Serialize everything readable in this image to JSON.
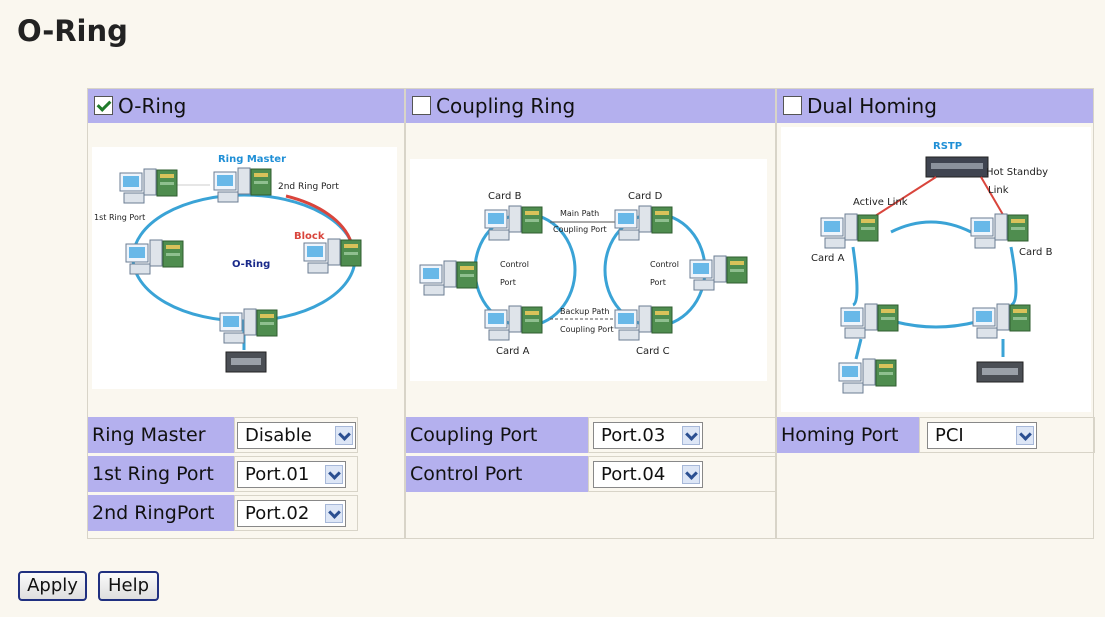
{
  "page": {
    "title": "O-Ring"
  },
  "oring": {
    "label": "O-Ring",
    "checked": true,
    "diagram": {
      "ring_master": "Ring Master",
      "first_ring_port": "1st Ring Port",
      "second_ring_port": "2nd Ring Port",
      "block": "Block",
      "center": "O-Ring"
    },
    "fields": [
      {
        "label": "Ring Master",
        "value": "Disable"
      },
      {
        "label": "1st Ring Port",
        "value": "Port.01"
      },
      {
        "label": "2nd RingPort",
        "value": "Port.02"
      }
    ]
  },
  "coupling": {
    "label": "Coupling Ring",
    "checked": false,
    "diagram": {
      "card_a": "Card A",
      "card_b": "Card B",
      "card_c": "Card C",
      "card_d": "Card D",
      "main_path": "Main Path",
      "coupling_port_top": "Coupling Port",
      "control_left": "Control",
      "port_left": "Port",
      "control_right": "Control",
      "port_right": "Port",
      "backup_path": "Backup Path",
      "coupling_port_bottom": "Coupling Port"
    },
    "fields": [
      {
        "label": "Coupling Port",
        "value": "Port.03"
      },
      {
        "label": "Control Port",
        "value": "Port.04"
      }
    ]
  },
  "homing": {
    "label": "Dual Homing",
    "checked": false,
    "diagram": {
      "rstp": "RSTP",
      "hot_standby": "Hot Standby",
      "link": "Link",
      "active_link": "Active Link",
      "card_a": "Card A",
      "card_b": "Card B"
    },
    "fields": [
      {
        "label": "Homing Port",
        "value": "PCI"
      }
    ]
  },
  "buttons": {
    "apply": "Apply",
    "help": "Help"
  },
  "colors": {
    "header": "#b4b0ee",
    "ring": "#3aa3d6",
    "block": "#d9453c",
    "title_blue": "#1f8fd6"
  }
}
